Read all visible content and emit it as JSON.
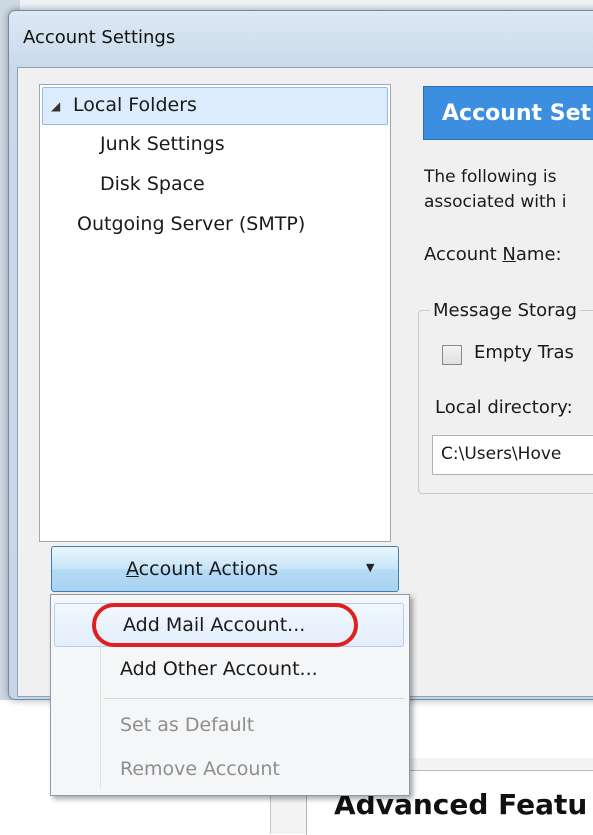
{
  "window": {
    "title": "Account Settings"
  },
  "tree": {
    "items": [
      {
        "label": "Local Folders",
        "expanded": true,
        "selected": true
      },
      {
        "label": "Junk Settings"
      },
      {
        "label": "Disk Space"
      },
      {
        "label": "Outgoing Server (SMTP)"
      }
    ]
  },
  "account_actions": {
    "label": "Account Actions",
    "mnemonic": "A"
  },
  "right_pane": {
    "banner": "Account Set",
    "description_line1": "The following is",
    "description_line2": "associated with i",
    "account_name_label": "Account Name:",
    "storage_group_title": "Message Storag",
    "empty_trash_label": "Empty Tras",
    "local_directory_label": "Local directory:",
    "local_directory_value": "C:\\Users\\Hove"
  },
  "menu": {
    "items": [
      {
        "label": "Add Mail Account...",
        "enabled": true,
        "highlighted": true
      },
      {
        "label": "Add Other Account...",
        "enabled": true
      },
      {
        "label": "Set as Default",
        "enabled": false
      },
      {
        "label": "Remove Account",
        "enabled": false
      }
    ]
  },
  "background": {
    "heading": "Advanced Featu"
  },
  "colors": {
    "banner": "#3c8fe0",
    "annotation": "#e02020",
    "selection": "#dcecfc"
  }
}
